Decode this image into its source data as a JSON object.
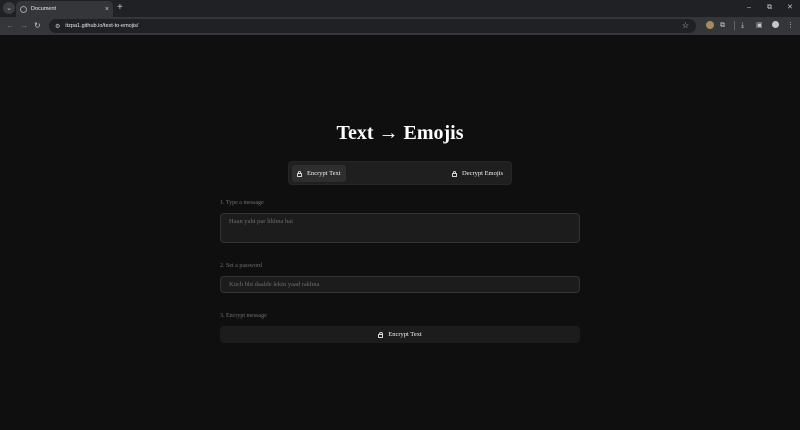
{
  "browser": {
    "tab_title": "Document",
    "tab_close": "×",
    "new_tab": "+",
    "url": "itzpa1.github.io/text-to-emojis/",
    "window_controls": {
      "minimize": "–",
      "restore": "⧉",
      "close": "✕"
    },
    "nav": {
      "back": "←",
      "forward": "→",
      "reload": "↻"
    },
    "icons": {
      "site_info": "⚙",
      "star": "☆",
      "extensions": "⧉",
      "downloads": "⤓",
      "sidepanel": "▣",
      "menu": "⋮",
      "tab_search": "⌄"
    }
  },
  "page": {
    "title": "Text → Emojis",
    "modes": {
      "encrypt_label": "Encrypt Text",
      "decrypt_label": "Decrypt Emojis",
      "active": "encrypt"
    },
    "step1_label": "1. Type a message",
    "message_placeholder": "Haan yahi par likhna hai",
    "message_value": "",
    "step2_label": "2. Set a password",
    "password_placeholder": "Kuch bhi daalde lekin yaad rakhna",
    "password_value": "",
    "step3_label": "3. Encrypt message",
    "encrypt_button_label": "Encrypt Text"
  },
  "colors": {
    "page_bg": "#0f0f0f",
    "surface": "#1c1c1c",
    "border": "#333333",
    "text": "#ffffff",
    "muted": "#6f6f6f"
  }
}
